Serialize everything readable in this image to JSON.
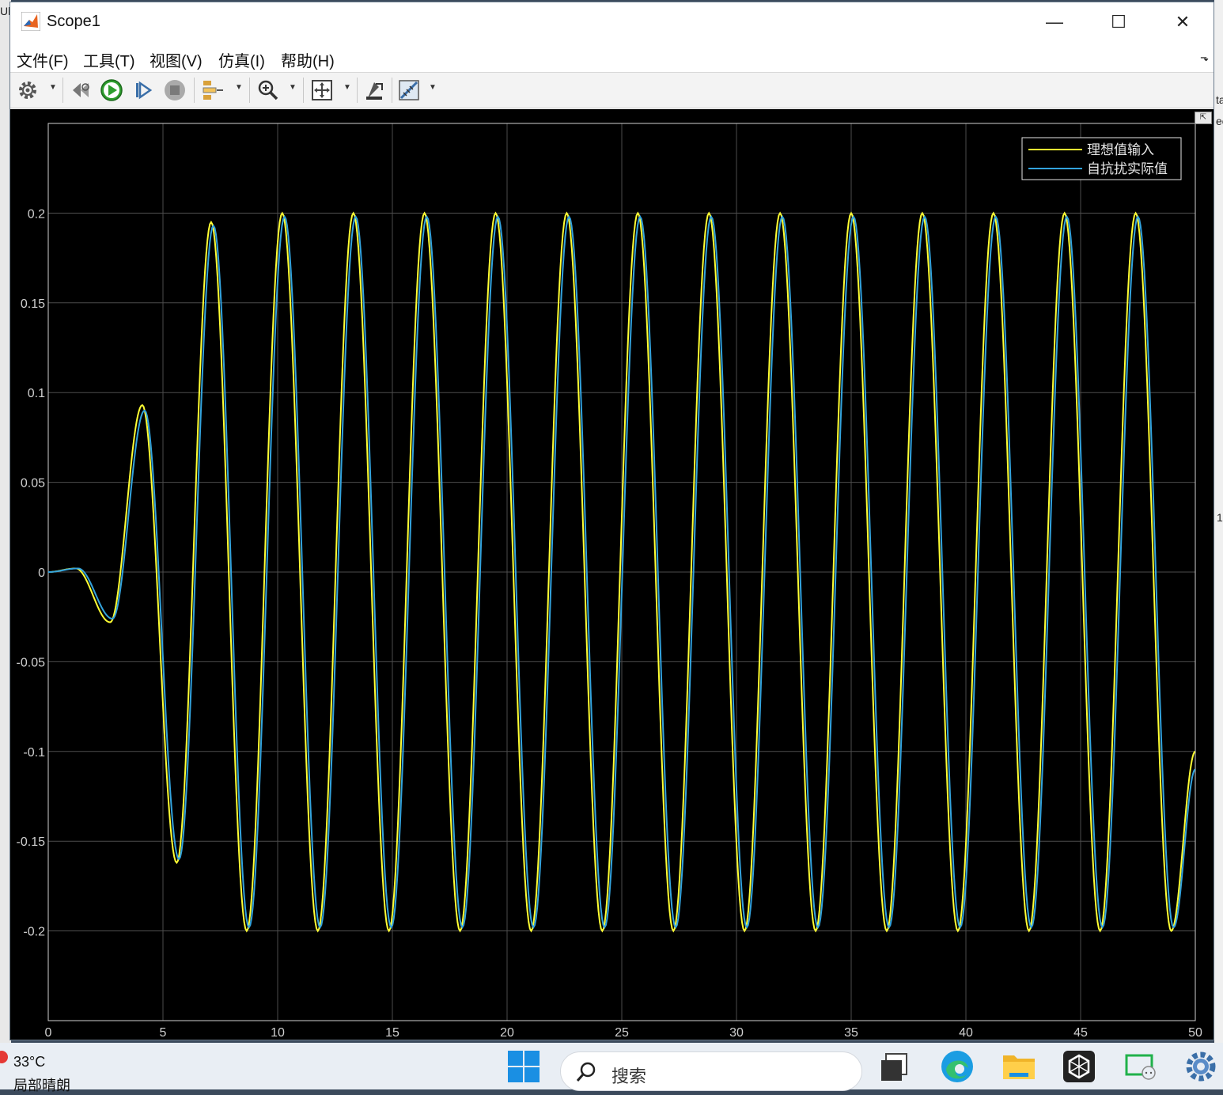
{
  "window": {
    "title": "Scope1",
    "minimize": "—",
    "maximize": "☐",
    "close": "✕"
  },
  "menu": {
    "items": [
      "文件(F)",
      "工具(T)",
      "视图(V)",
      "仿真(I)",
      "帮助(H)"
    ],
    "overflow": "⬎"
  },
  "toolbar": {
    "buttons": [
      "settings-icon",
      "step-back-icon",
      "run-icon",
      "step-forward-icon",
      "stop-icon",
      "signal-select-icon",
      "zoom-icon",
      "autoscale-icon",
      "style-icon",
      "measure-icon"
    ],
    "colors": {
      "run": "#2e9e2e",
      "stop": "#8a8a8a"
    }
  },
  "backdrop": {
    "left_fragment": "Ul",
    "right_fragment_1": "ta",
    "right_fragment_2": "ec",
    "right_fragment_3": "1"
  },
  "chart_data": {
    "type": "line",
    "title": "",
    "xlabel": "",
    "ylabel": "",
    "xlim": [
      0,
      50
    ],
    "ylim": [
      -0.25,
      0.25
    ],
    "xticks": [
      "0",
      "5",
      "10",
      "15",
      "20",
      "25",
      "30",
      "35",
      "40",
      "45",
      "50"
    ],
    "yticks": [
      "0.2",
      "0.15",
      "0.1",
      "0.05",
      "0",
      "-0.05",
      "-0.1",
      "-0.15",
      "-0.2"
    ],
    "ytick_values": [
      0.2,
      0.15,
      0.1,
      0.05,
      0,
      -0.05,
      -0.1,
      -0.15,
      -0.2
    ],
    "grid": true,
    "background": "#000000",
    "legend_position": "top-right",
    "series": [
      {
        "name": "理想值输入",
        "color": "#ffff33",
        "x": [
          0,
          1.2,
          2.7,
          4.1,
          5.6,
          7.1,
          8.65,
          10.2,
          11.75,
          13.3,
          14.85,
          16.4,
          17.95,
          19.5,
          21.05,
          22.6,
          24.15,
          25.7,
          27.25,
          28.8,
          30.35,
          31.9,
          33.45,
          35.0,
          36.55,
          38.1,
          39.65,
          41.2,
          42.75,
          44.3,
          45.85,
          47.4,
          48.95,
          50
        ],
        "y": [
          0,
          0.002,
          -0.028,
          0.093,
          -0.162,
          0.195,
          -0.2,
          0.2,
          -0.2,
          0.2,
          -0.2,
          0.2,
          -0.2,
          0.2,
          -0.2,
          0.2,
          -0.2,
          0.2,
          -0.2,
          0.2,
          -0.2,
          0.2,
          -0.2,
          0.2,
          -0.2,
          0.2,
          -0.2,
          0.2,
          -0.2,
          0.2,
          -0.2,
          0.2,
          -0.2,
          -0.1
        ]
      },
      {
        "name": "自抗扰实际值",
        "color": "#33a3dd",
        "x": [
          0,
          1.3,
          2.8,
          4.2,
          5.7,
          7.2,
          8.75,
          10.3,
          11.85,
          13.4,
          14.95,
          16.5,
          18.05,
          19.6,
          21.15,
          22.7,
          24.25,
          25.8,
          27.35,
          28.9,
          30.45,
          32.0,
          33.55,
          35.1,
          36.65,
          38.2,
          39.75,
          41.3,
          42.85,
          44.4,
          45.95,
          47.5,
          49.05,
          50
        ],
        "y": [
          0,
          0.002,
          -0.026,
          0.09,
          -0.16,
          0.193,
          -0.198,
          0.198,
          -0.198,
          0.198,
          -0.198,
          0.198,
          -0.198,
          0.198,
          -0.198,
          0.198,
          -0.198,
          0.198,
          -0.198,
          0.198,
          -0.198,
          0.198,
          -0.198,
          0.198,
          -0.198,
          0.198,
          -0.198,
          0.198,
          -0.198,
          0.198,
          -0.198,
          0.198,
          -0.198,
          -0.11
        ]
      }
    ]
  },
  "taskbar": {
    "temperature": "33°C",
    "weather": "局部晴朗",
    "search_placeholder": "搜索",
    "apps": [
      "start-icon",
      "task-view-icon",
      "edge-icon",
      "file-explorer-icon",
      "unity-icon",
      "wechat-icon",
      "settings-icon"
    ]
  }
}
